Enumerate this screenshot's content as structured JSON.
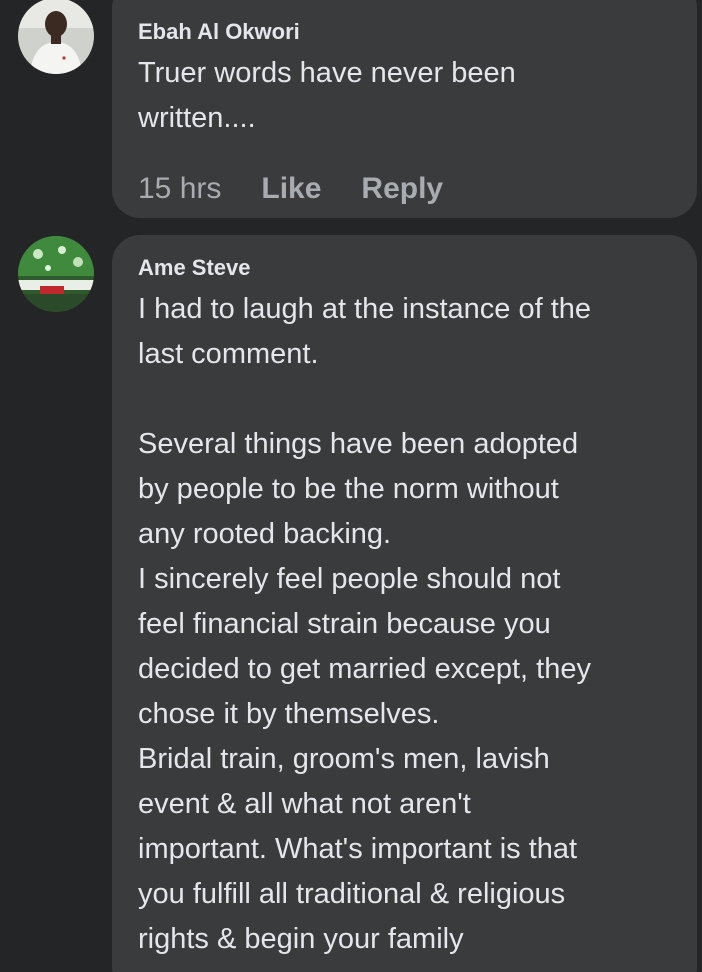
{
  "comments": [
    {
      "author": "Ebah Al Okwori",
      "text": "Truer words have never been\nwritten....",
      "time": "15 hrs",
      "like_label": "Like",
      "reply_label": "Reply"
    },
    {
      "author": "Ame Steve",
      "text": "I had to laugh at the instance of the\nlast comment.\n\nSeveral things have been adopted\nby people to be the norm without\nany rooted backing.\nI sincerely feel people should not\nfeel financial strain because you\ndecided to get married except, they\nchose it by themselves.\nBridal train, groom's men, lavish\nevent & all what not aren't\nimportant. What's important is that\nyou fulfill all traditional & religious\nrights & begin your family"
    }
  ],
  "colors": {
    "background": "#242526",
    "bubble": "#3a3b3c",
    "text": "#e4e6eb",
    "secondary_text": "#b0b3b8"
  }
}
